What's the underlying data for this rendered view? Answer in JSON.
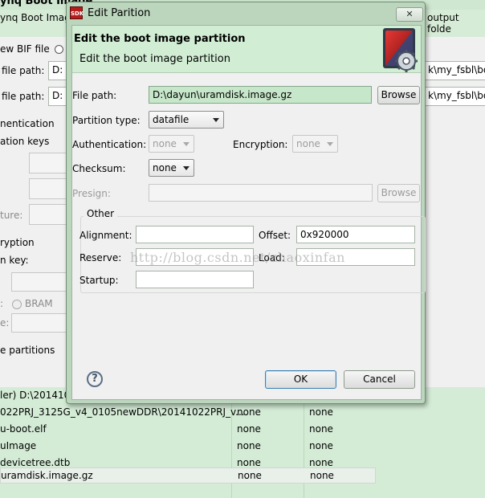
{
  "background": {
    "title": "ynq Boot Image",
    "header_left": "ynq Boot Imag",
    "header_right": "output folde",
    "rows": [
      {
        "label": "ew BIF file",
        "radio": true
      },
      {
        "label": "file path:",
        "value_left": "D:",
        "value_right": "k\\my_fsbl\\bo"
      },
      {
        "label": "file path:",
        "value_left": "D:",
        "value_right": "k\\my_fsbl\\bo"
      }
    ],
    "section_authentication": "nentication",
    "section_ation_keys": "ation keys",
    "ture_label": "ture:",
    "encryption_label": "ryption",
    "key_label": "n key:",
    "bram_label": "BRAM",
    "e_label": "e:",
    "partitions_label": "e partitions",
    "table_rows": [
      {
        "name": "ler) D:\\201410",
        "auth": "",
        "enc": ""
      },
      {
        "name": "022PRJ_3125G_v4_0105newDDR\\20141022PRJ_v...",
        "auth": "none",
        "enc": "none"
      },
      {
        "name": "u-boot.elf",
        "auth": "none",
        "enc": "none"
      },
      {
        "name": "uImage",
        "auth": "none",
        "enc": "none"
      },
      {
        "name": "devicetree.dtb",
        "auth": "none",
        "enc": "none"
      },
      {
        "name": "uramdisk.image.gz",
        "auth": "none",
        "enc": "none"
      }
    ]
  },
  "dialog": {
    "title": "Edit Parition",
    "icon_text": "SDK",
    "close_label": "✕",
    "banner_title": "Edit the boot image partition",
    "banner_subtitle": "Edit the boot image partition",
    "file_path_label": "File path:",
    "file_path_value": "D:\\dayun\\uramdisk.image.gz",
    "browse_label": "Browse",
    "partition_type_label": "Partition type:",
    "partition_type_value": "datafile",
    "authentication_label": "Authentication:",
    "authentication_value": "none",
    "encryption_label": "Encryption:",
    "encryption_value": "none",
    "checksum_label": "Checksum:",
    "checksum_value": "none",
    "presign_label": "Presign:",
    "presign_value": "",
    "presign_browse_label": "Browse",
    "other_group_label": "Other",
    "alignment_label": "Alignment:",
    "alignment_value": "",
    "offset_label": "Offset:",
    "offset_value": "0x920000",
    "reserve_label": "Reserve:",
    "reserve_value": "",
    "load_label": "Load:",
    "load_value": "",
    "startup_label": "Startup:",
    "startup_value": "",
    "help_label": "?",
    "ok_label": "OK",
    "cancel_label": "Cancel"
  },
  "watermark": "http://blog.csdn.net/zhaoxinfan",
  "colors": {
    "banner_bg": "#d1edd3",
    "selection_green": "#c7e7ca",
    "brand_red": "#b71c1c"
  }
}
